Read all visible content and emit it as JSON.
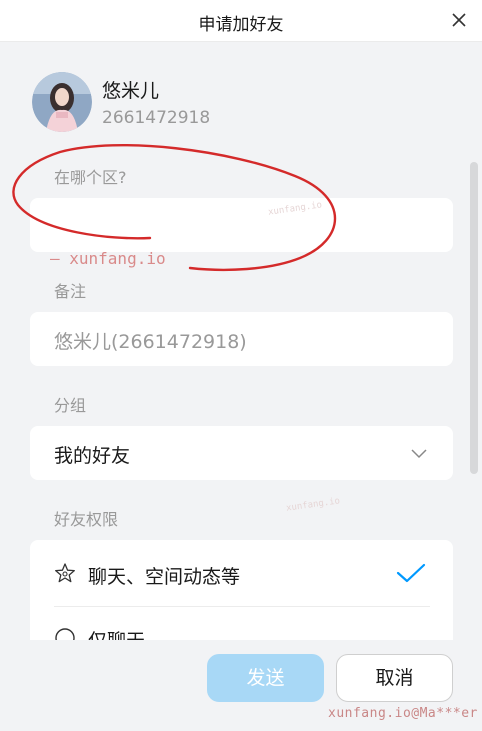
{
  "window": {
    "title": "申请加好友"
  },
  "profile": {
    "nickname": "悠米儿",
    "uin": "2661472918"
  },
  "region": {
    "label": "在哪个区?",
    "value": ""
  },
  "remark": {
    "label": "备注",
    "value": "悠米儿(2661472918)"
  },
  "group": {
    "label": "分组",
    "selected": "我的好友"
  },
  "permission": {
    "label": "好友权限",
    "options": [
      {
        "label": "聊天、空间动态等",
        "checked": true
      },
      {
        "label": "仅聊天",
        "checked": false
      }
    ]
  },
  "buttons": {
    "send": "发送",
    "cancel": "取消"
  },
  "watermarks": {
    "inline": "— xunfang.io",
    "footer": "xunfang.io@Ma***er",
    "faint_1": "xunfang.io",
    "faint_2": "xunfang.io"
  },
  "colors": {
    "accent": "#0099ff",
    "send_disabled_bg": "#a8d8f6",
    "annotation_red": "#d42a2a",
    "window_bg": "#f2f3f5"
  }
}
